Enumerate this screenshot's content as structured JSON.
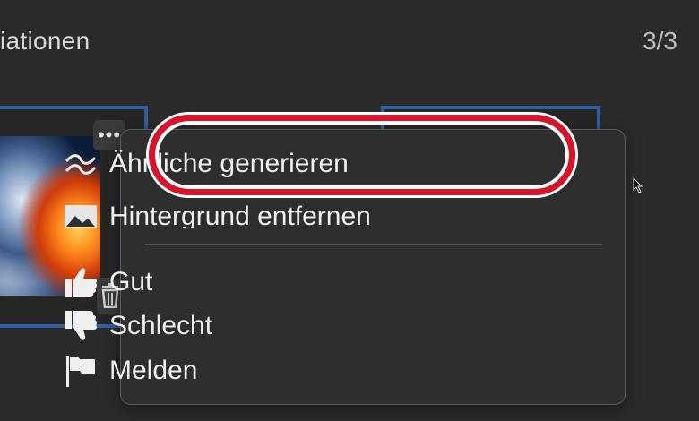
{
  "panel": {
    "title": "iationen",
    "counter": "3/3"
  },
  "variation": {
    "more_label": "•••",
    "more_icon": "more-horizontal-icon",
    "delete_icon": "trash-icon"
  },
  "context_menu": {
    "items": [
      {
        "label": "Ähnliche generieren",
        "icon": "approx-equal-icon",
        "highlighted": true
      },
      {
        "label": "Hintergrund entfernen",
        "icon": "image-icon"
      },
      {
        "label": "Gut",
        "icon": "thumbs-up-icon"
      },
      {
        "label": "Schlecht",
        "icon": "thumbs-down-icon"
      },
      {
        "label": "Melden",
        "icon": "flag-icon"
      }
    ]
  },
  "colors": {
    "background": "#2b2b2b",
    "menu_background": "#2e2e2e",
    "selection_border": "#2f5f9e",
    "highlight_ring": "#d8142b"
  }
}
